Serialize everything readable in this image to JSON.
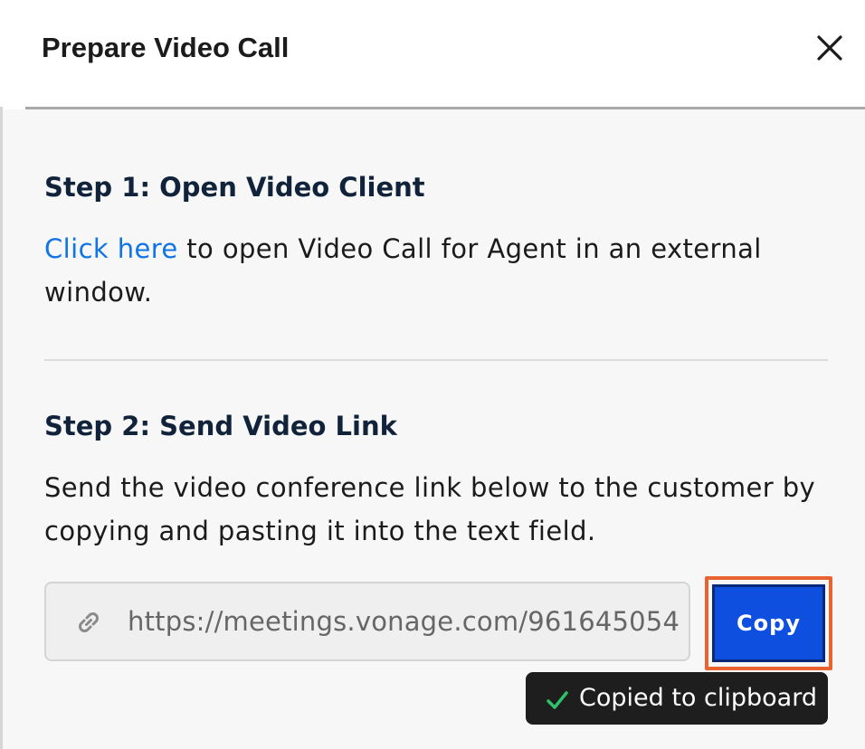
{
  "dialog": {
    "title": "Prepare Video Call",
    "close_icon": "close-icon"
  },
  "step1": {
    "heading": "Step 1: Open Video Client",
    "link_text": "Click here",
    "text_after_link": " to open Video Call for Agent in an external window."
  },
  "step2": {
    "heading": "Step 2: Send Video Link",
    "description": "Send the video conference link below to the customer by copying and pasting it into the text field.",
    "url_icon": "link-icon",
    "url_value": "https://meetings.vonage.com/961645054",
    "copy_label": "Copy"
  },
  "tooltip": {
    "icon": "check-icon",
    "text": "Copied to clipboard"
  },
  "colors": {
    "link": "#1174e6",
    "copy_button": "#0e4fe0",
    "highlight": "#e8632d",
    "check": "#2ec26b"
  }
}
